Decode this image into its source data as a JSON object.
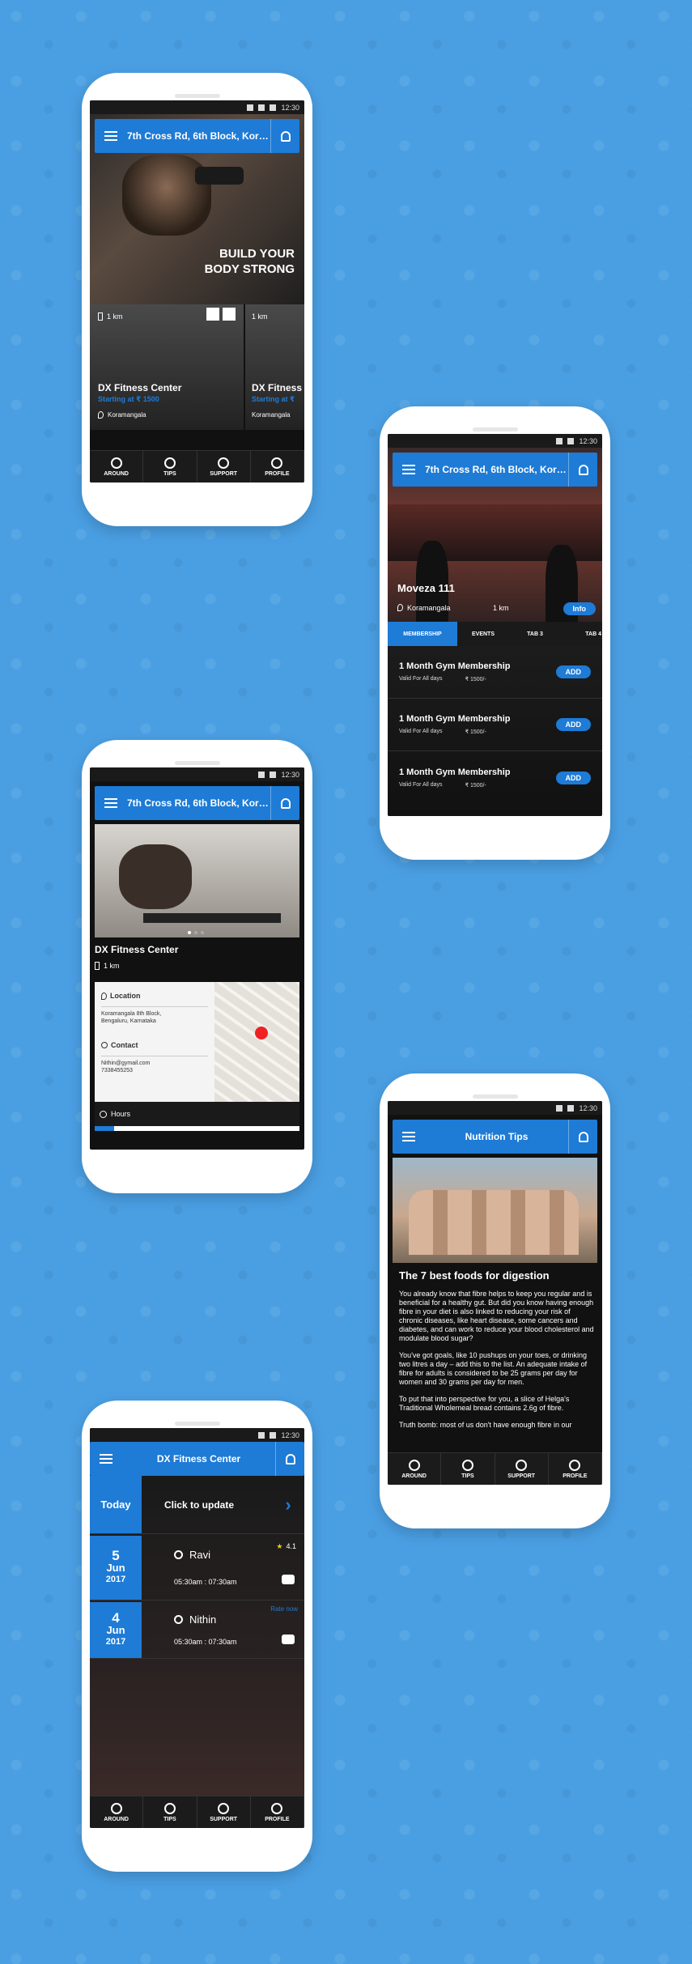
{
  "status": {
    "time": "12:30"
  },
  "location_title": "7th Cross Rd, 6th Block, Koram...",
  "bottom_tabs": [
    "AROUND",
    "TIPS",
    "SUPPORT",
    "PROFILE"
  ],
  "screen1": {
    "hero_text_line1": "BUILD YOUR",
    "hero_text_line2": "BODY STRONG",
    "cards": [
      {
        "distance": "1 km",
        "name": "DX Fitness Center",
        "starting": "Starting at ₹ 1500",
        "area": "Koramangala"
      },
      {
        "distance": "1 km",
        "name": "DX Fitness",
        "starting": "Starting at ₹",
        "area": "Koramangala"
      }
    ]
  },
  "screen2": {
    "gym_name": "Moveza 111",
    "area": "Koramangala",
    "distance": "1 km",
    "info_label": "Info",
    "tabs": [
      "MEMBERSHIP",
      "EVENTS",
      "TAB 3",
      "TAB 4"
    ],
    "memberships": [
      {
        "name": "1 Month Gym Membership",
        "valid": "Valid For All days",
        "price": "₹ 1500/-",
        "action": "ADD"
      },
      {
        "name": "1 Month Gym Membership",
        "valid": "Valid For All days",
        "price": "₹ 1500/-",
        "action": "ADD"
      },
      {
        "name": "1 Month Gym Membership",
        "valid": "Valid For All days",
        "price": "₹ 1500/-",
        "action": "ADD"
      }
    ]
  },
  "screen3": {
    "gym_name": "DX Fitness Center",
    "distance": "1 km",
    "location_label": "Location",
    "location_value_1": "Koramangala 8th Block,",
    "location_value_2": "Bengaluru, Karnataka",
    "contact_label": "Contact",
    "contact_email": "Nithin@gymail.com",
    "contact_phone": "7338455253",
    "hours_label": "Hours"
  },
  "screen4": {
    "title": "Nutrition Tips",
    "headline": "The 7 best foods for digestion",
    "paragraphs": [
      "You already know that fibre helps to keep you regular and is beneficial for a healthy gut. But did you know having enough fibre in your diet is also linked to reducing your risk of chronic diseases, like heart disease, some cancers and diabetes, and can work to reduce your blood cholesterol and modulate blood sugar?",
      "You've got goals, like 10 pushups on your toes, or drinking two litres a day – add this to the list. An adequate intake of fibre for adults is considered to be 25 grams per day for women and 30 grams per day for men.",
      "To put that into perspective for you, a slice of Helga's Traditional Wholemeal bread contains 2.6g of fibre.",
      "Truth bomb: most of us don't have enough fibre in our"
    ]
  },
  "screen5": {
    "title": "DX Fitness Center",
    "today_label": "Today",
    "update_label": "Click to update",
    "sessions": [
      {
        "day": "5",
        "month": "Jun",
        "year": "2017",
        "name": "Ravi",
        "time": "05:30am : 07:30am",
        "rating": "4.1"
      },
      {
        "day": "4",
        "month": "Jun",
        "year": "2017",
        "name": "Nithin",
        "time": "05:30am : 07:30am",
        "rate_now": "Rate now"
      }
    ]
  },
  "colors": {
    "background": "#4a9fe3",
    "accent": "#1e7bd6",
    "dark": "#111111"
  }
}
